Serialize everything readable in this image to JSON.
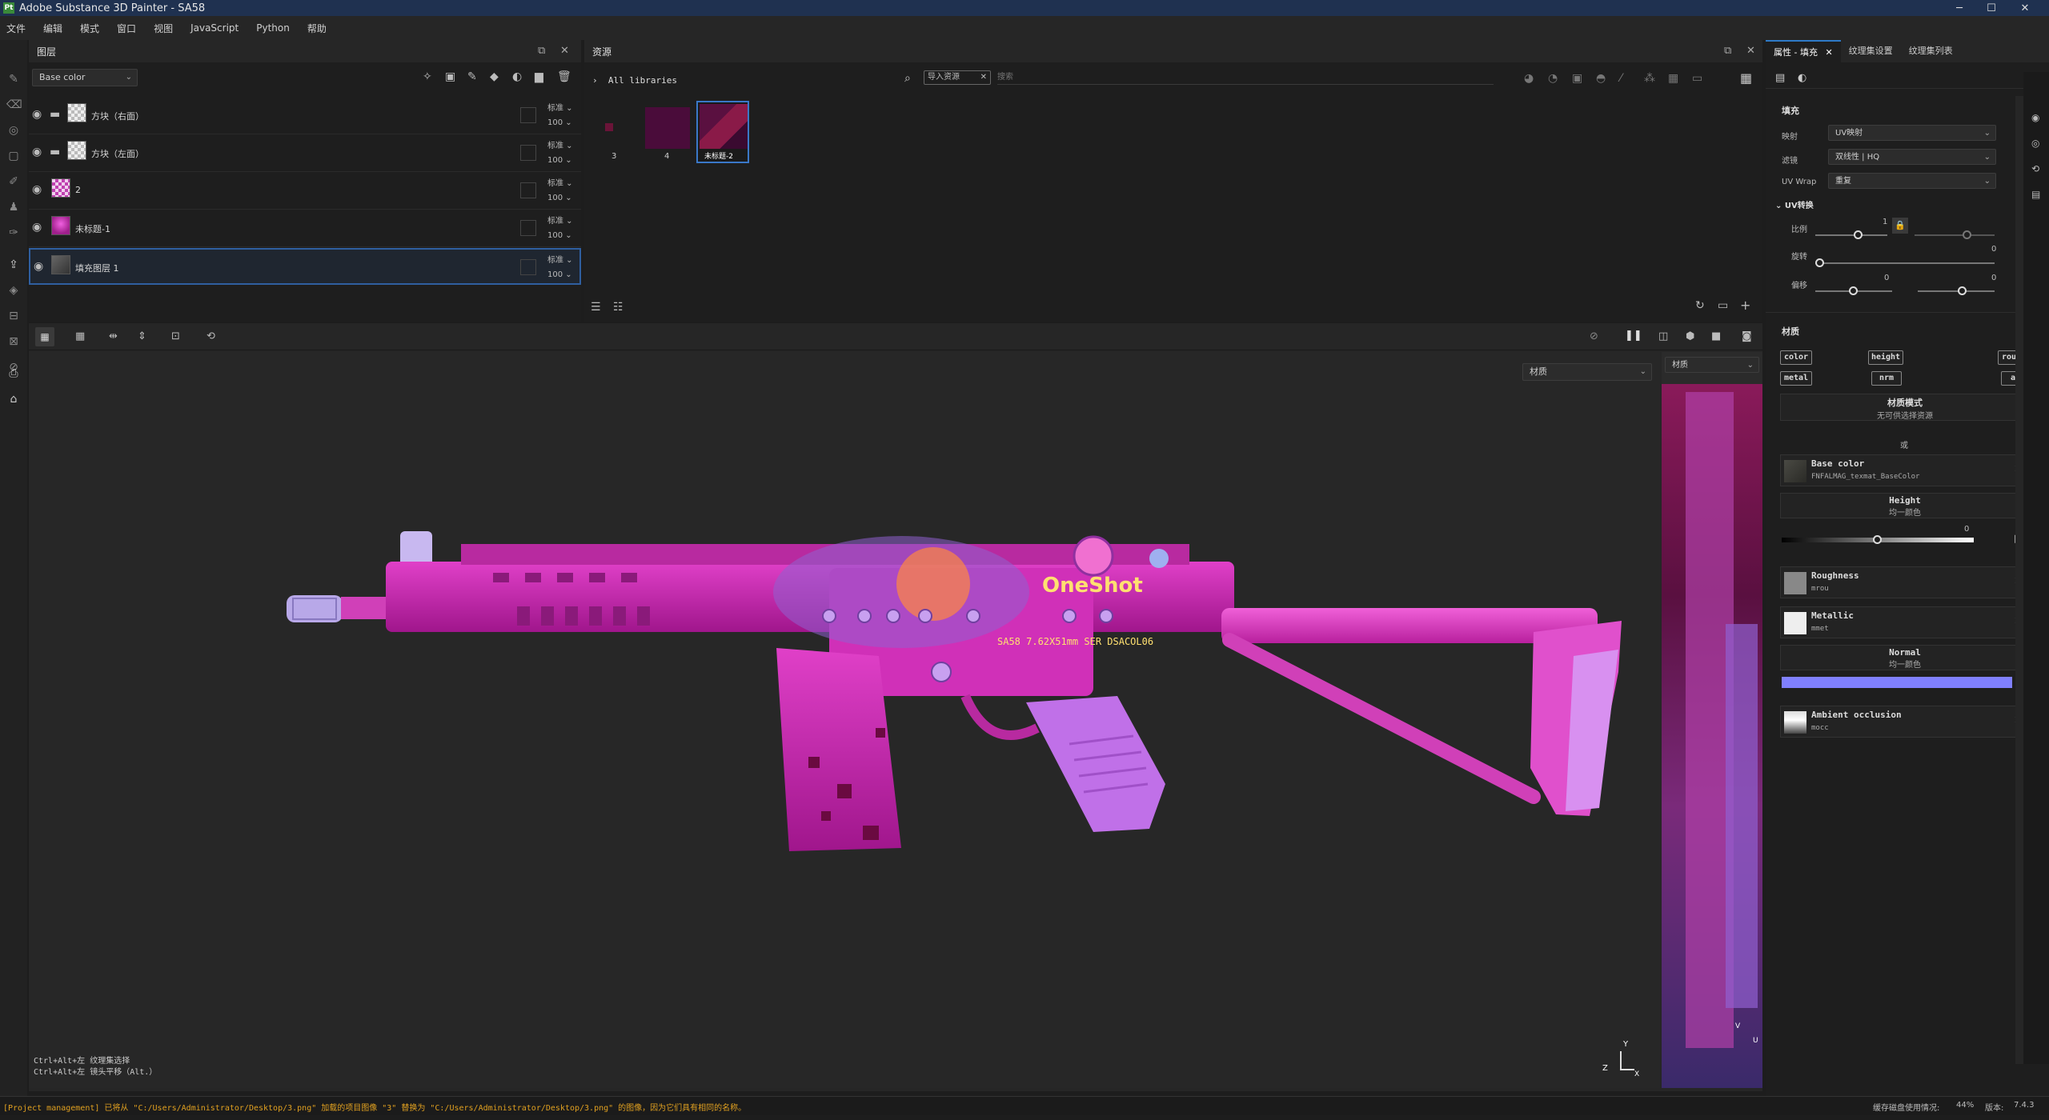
{
  "window": {
    "title": "Adobe Substance 3D Painter - SA58",
    "logo": "Pt"
  },
  "menu": [
    "文件",
    "编辑",
    "模式",
    "窗口",
    "视图",
    "JavaScript",
    "Python",
    "帮助"
  ],
  "layers_panel": {
    "title": "图层",
    "channel_select": "Base color",
    "layers": [
      {
        "name": "方块（右面）",
        "blend": "标准",
        "opacity": "100",
        "type": "folder"
      },
      {
        "name": "方块（左面）",
        "blend": "标准",
        "opacity": "100",
        "type": "folder"
      },
      {
        "name": "2",
        "blend": "标准",
        "opacity": "100",
        "type": "layer"
      },
      {
        "name": "未标题-1",
        "blend": "标准",
        "opacity": "100",
        "type": "layer"
      },
      {
        "name": "填充图层 1",
        "blend": "标准",
        "opacity": "100",
        "type": "fill",
        "selected": true
      }
    ]
  },
  "assets_panel": {
    "title": "资源",
    "library": "All libraries",
    "filter_chip": "导入资源",
    "search_placeholder": "搜索",
    "items": [
      {
        "label": "3",
        "color": "#6a1438"
      },
      {
        "label": "4",
        "color": "#4a0c3a"
      },
      {
        "label": "未标题-2",
        "color": "#5a1040"
      }
    ]
  },
  "viewport": {
    "mode_3d": "材质",
    "mode_2d": "材质",
    "hint_line1": "Ctrl+Alt+左 纹理集选择",
    "hint_line2": "Ctrl+Alt+左 镜头平移（Alt.）",
    "decal_text": "SA58 7.62X51mm SER DSACOL06",
    "logo_text": "OneShot",
    "axis_y": "Y",
    "axis_z": "Z",
    "axis_x": "X",
    "uv_v": "V",
    "uv_u": "U"
  },
  "properties": {
    "tabs": [
      "属性 - 填充",
      "纹理集设置",
      "纹理集列表"
    ],
    "section_fill": "填充",
    "mapping_label": "映射",
    "mapping_value": "UV映射",
    "filter_label": "滤镜",
    "filter_value": "双线性 | HQ",
    "uvwrap_label": "UV Wrap",
    "uvwrap_value": "重复",
    "uv_transform": "UV转换",
    "scale_label": "比例",
    "scale_value": "1",
    "rotation_label": "旋转",
    "rotation_value": "0",
    "offset_label": "偏移",
    "offset_x": "0",
    "offset_y": "0",
    "section_material": "材质",
    "channels": [
      "color",
      "height",
      "rough",
      "metal",
      "nrm",
      "ao"
    ],
    "material_mode": "材质模式",
    "material_mode_sub": "无可供选择资源",
    "or_label": "或",
    "slots": {
      "base_color": {
        "title": "Base color",
        "sub": "FNFALMAG_texmat_BaseColor"
      },
      "height": {
        "title": "Height",
        "sub": "均一颜色",
        "value": "0"
      },
      "roughness": {
        "title": "Roughness",
        "sub": "mrou"
      },
      "metallic": {
        "title": "Metallic",
        "sub": "mmet"
      },
      "normal": {
        "title": "Normal",
        "sub": "均一颜色"
      },
      "ao": {
        "title": "Ambient occlusion",
        "sub": "mocc"
      }
    },
    "normal_color": "#8080ff"
  },
  "status": {
    "message": "[Project management] 已将从 \"C:/Users/Administrator/Desktop/3.png\" 加载的项目图像 \"3\" 替换为 \"C:/Users/Administrator/Desktop/3.png\" 的图像，因为它们具有相同的名称。",
    "cache_label": "缓存磁盘使用情况:",
    "cache_value": "44%",
    "version_label": "版本:",
    "version_value": "7.4.3"
  }
}
